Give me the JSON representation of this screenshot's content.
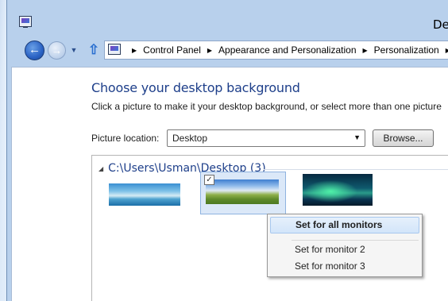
{
  "window": {
    "title": "De"
  },
  "navigation": {
    "back_glyph": "back-arrow-icon",
    "forward_glyph": "forward-arrow-icon",
    "breadcrumbs": [
      "Control Panel",
      "Appearance and Personalization",
      "Personalization"
    ]
  },
  "main": {
    "heading": "Choose your desktop background",
    "subtext": "Click a picture to make it your desktop background, or select more than one picture",
    "picture_location_label": "Picture location:",
    "picture_location_value": "Desktop",
    "browse_label": "Browse..."
  },
  "gallery": {
    "group_title": "C:\\Users\\Usman\\Desktop (3)",
    "thumbnails": [
      {
        "name": "panorama-sea",
        "selected": false
      },
      {
        "name": "grass-field-sky",
        "selected": true
      },
      {
        "name": "aurora-lake",
        "selected": false
      }
    ]
  },
  "context_menu": {
    "items": [
      "Set for all monitors",
      "Set for monitor 2",
      "Set for monitor 3"
    ],
    "highlighted_index": 0
  },
  "colors": {
    "heading": "#1e3f8a",
    "window_chrome": "#b8d0ec",
    "menu_highlight": "#d2e5fa"
  }
}
